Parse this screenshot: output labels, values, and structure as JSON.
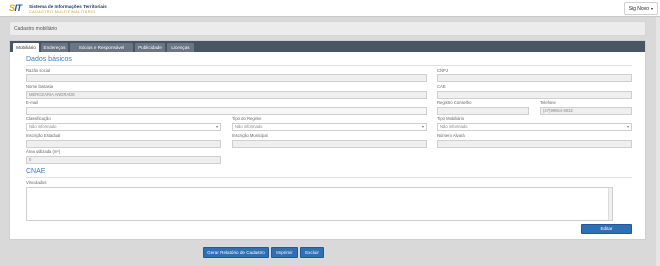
{
  "header": {
    "logo_mark_a": "S",
    "logo_mark_b": "IT",
    "logo_title": "Sistema de Informações Territoriais",
    "logo_subtitle": "CADASTRO MULTIFINALITÁRIO",
    "user_label": "Sig Novo",
    "caret": "▾"
  },
  "panel": {
    "title": "Cadastro mobiliário"
  },
  "tabs": [
    {
      "label": "Mobiliário",
      "active": true
    },
    {
      "label": "Endereços"
    },
    {
      "label": "Sócios e Responsável"
    },
    {
      "label": "Publicidade"
    },
    {
      "label": "Licenças"
    }
  ],
  "dados_basicos": {
    "title": "Dados básicos",
    "razao_social": {
      "label": "Razão social",
      "value": ""
    },
    "cnpj": {
      "label": "CNPJ",
      "value": ""
    },
    "nome_fantasia": {
      "label": "Nome fantasia",
      "value": "MERCEARIA ANDRADE"
    },
    "cae": {
      "label": "CAE",
      "value": ""
    },
    "email": {
      "label": "E-mail",
      "value": ""
    },
    "registro_conselho": {
      "label": "Registro Conselho",
      "value": ""
    },
    "telefone": {
      "label": "Telefone",
      "value": "(47)99654-8032"
    },
    "classificacao": {
      "label": "Classificação",
      "value": "Não informado"
    },
    "tipo_regime": {
      "label": "Tipo do Regime",
      "value": "Não informado"
    },
    "tipo_mobiliario": {
      "label": "Tipo Mobiliário",
      "value": "Não informado"
    },
    "inscricao_estadual": {
      "label": "Inscrição Estadual",
      "value": ""
    },
    "inscricao_municipal": {
      "label": "Inscrição Municipal",
      "value": ""
    },
    "numero_alvara": {
      "label": "Número Alvará",
      "value": ""
    },
    "area_utilizada": {
      "label": "Área utilizada (m²)",
      "value": "0"
    }
  },
  "cnae": {
    "title": "CNAE",
    "vinculados_label": "Vinculados",
    "editar_label": "Editar"
  },
  "actions": {
    "gerar_label": "Gerar Relatório de Cadastro",
    "imprimir_label": "Imprimir",
    "excluir_label": "Excluir"
  },
  "colors": {
    "accent": "#2f6fb5",
    "tabbar": "#4a5563",
    "section_title": "#3d7bc4"
  }
}
